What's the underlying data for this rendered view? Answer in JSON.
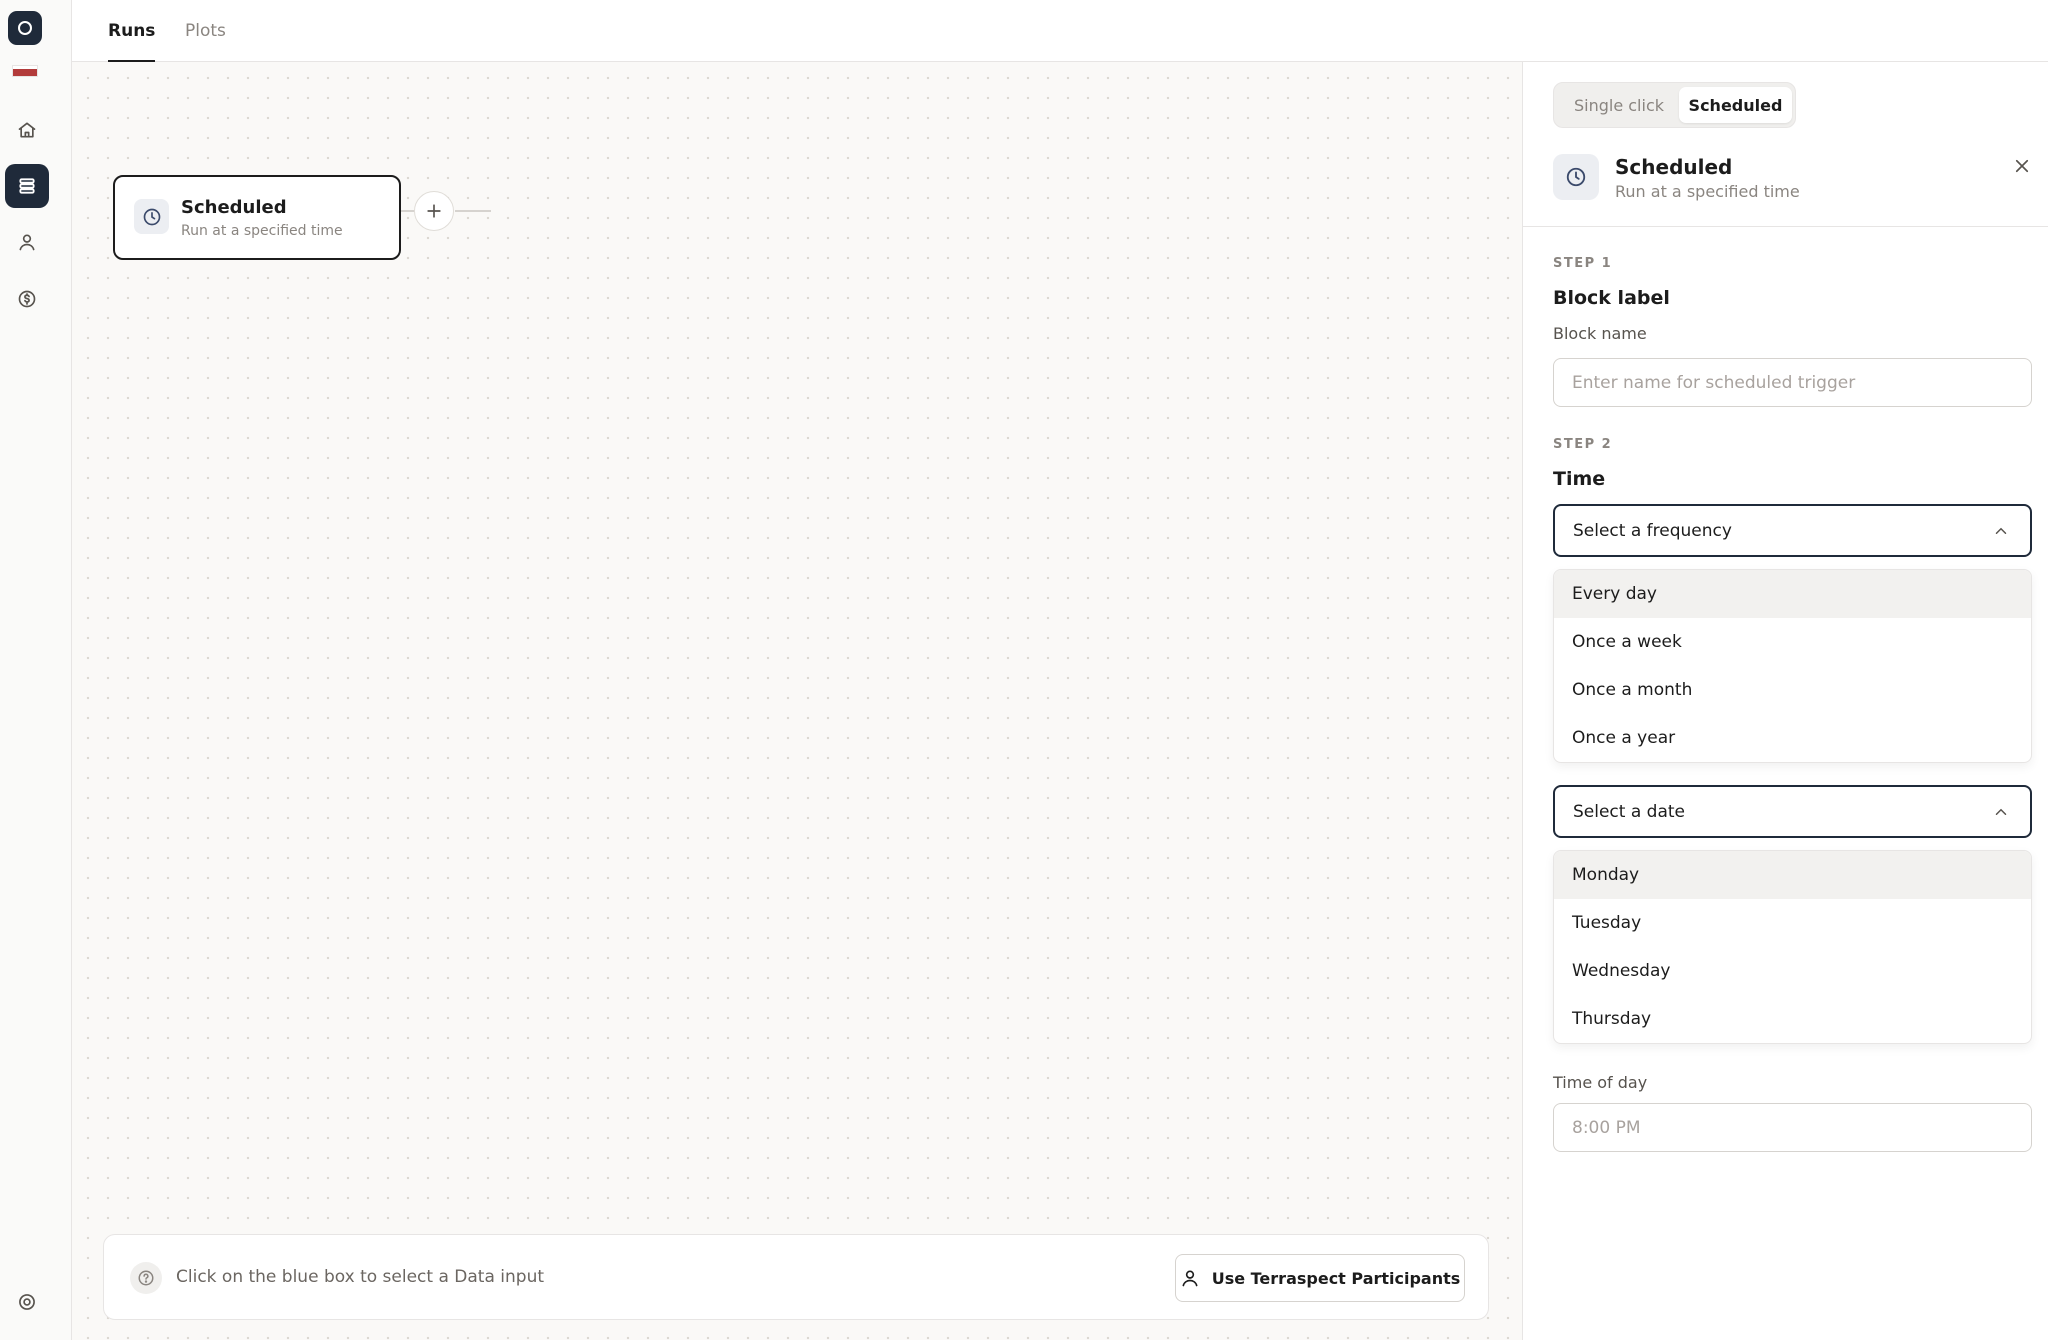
{
  "nav": {
    "tabs": [
      {
        "label": "Runs"
      },
      {
        "label": "Plots"
      }
    ]
  },
  "canvas": {
    "node": {
      "title": "Scheduled",
      "subtitle": "Run at a specified time"
    },
    "hint": "Click on the blue box to select a Data input",
    "participants_button": "Use Terraspect Participants"
  },
  "panel": {
    "segment": {
      "options": [
        "Single click",
        "Scheduled"
      ],
      "selected": "Scheduled"
    },
    "header": {
      "title": "Scheduled",
      "subtitle": "Run at a specified time"
    },
    "step1": {
      "label": "STEP 1",
      "title": "Block label",
      "field_label": "Block name",
      "placeholder": "Enter name for scheduled trigger"
    },
    "step2": {
      "label": "STEP 2",
      "title": "Time",
      "frequency": {
        "value": "Select a frequency",
        "options": [
          "Every day",
          "Once a week",
          "Once a month",
          "Once a year"
        ]
      },
      "date": {
        "value": "Select a date",
        "options": [
          "Monday",
          "Tuesday",
          "Wednesday",
          "Thursday"
        ]
      },
      "time_label": "Time of day",
      "time_placeholder": "8:00 PM"
    }
  },
  "colors": {
    "accent": "#1f2a3a",
    "canvas_bg": "#faf9f7",
    "border": "#e7e5e4",
    "muted_text": "#8a8580"
  },
  "icons": {
    "rail": [
      "logo-icon",
      "flag-icon",
      "home-icon",
      "database-icon",
      "user-icon",
      "dollar-icon",
      "settings-icon"
    ],
    "node": "clock-icon",
    "close": "close-icon",
    "chevron": "chevron-up-icon"
  }
}
